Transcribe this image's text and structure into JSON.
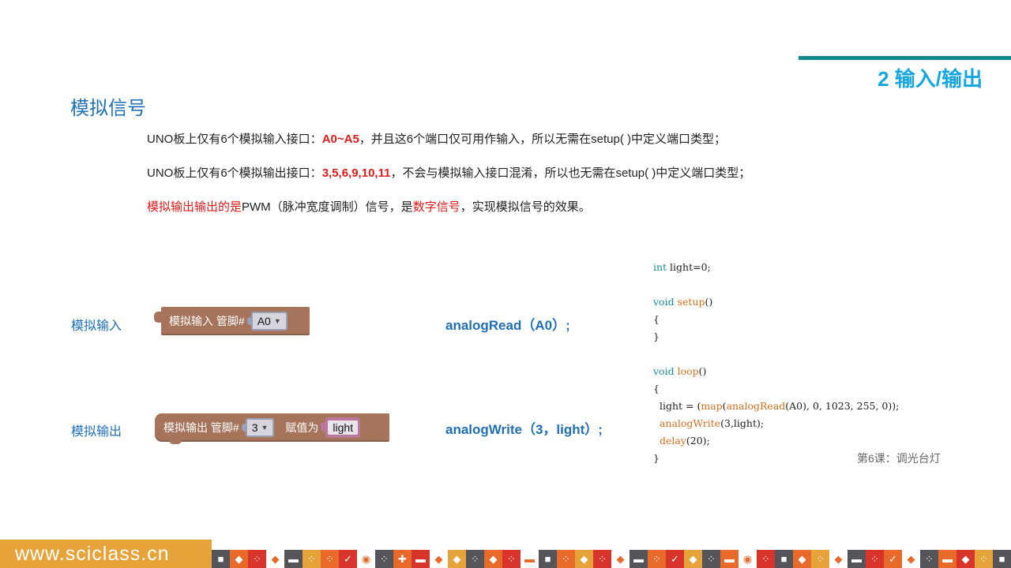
{
  "header": {
    "section_heading": "2 输入/输出",
    "title": "模拟信号"
  },
  "paragraphs": {
    "p1": {
      "prefix": "UNO板上仅有6个模拟输入接口：",
      "highlight": "A0~A5",
      "suffix": "，并且这6个端口仅可用作输入，所以无需在setup( )中定义端口类型；"
    },
    "p2": {
      "prefix": "UNO板上仅有6个模拟输出接口：",
      "highlight": "3,5,6,9,10,11",
      "suffix": "，不会与模拟输入接口混淆，所以也无需在setup( )中定义端口类型；"
    },
    "p3": {
      "red1": "模拟输出输出的是",
      "mid1": "PWM（脉冲宽度调制）信号，是",
      "red2": "数字信号",
      "end": "，实现模拟信号的效果。"
    }
  },
  "rows": {
    "input": {
      "label": "模拟输入",
      "block_text": "模拟输入 管脚#",
      "pin_value": "A0",
      "code": "analogRead（A0）;"
    },
    "output": {
      "label": "模拟输出",
      "block_text": "模拟输出 管脚#",
      "pin_value": "3",
      "assign_label": "赋值为",
      "var_value": "light",
      "code": "analogWrite（3，light）;"
    }
  },
  "code": {
    "l1_kw": "int",
    "l1_rest": " light=0;",
    "l3_kw": "void",
    "l3_fn": " setup",
    "l3_rest": "()",
    "l4": "{",
    "l5": "}",
    "l7_kw": "void",
    "l7_fn": " loop",
    "l7_rest": "()",
    "l8": "{",
    "l9_a": "  light = (",
    "l9_map": "map",
    "l9_b": "(",
    "l9_ar": "analogRead",
    "l9_c": "(A0), 0, 1023, 255, 0));",
    "l10_a": "  ",
    "l10_aw": "analogWrite",
    "l10_b": "(3,light);",
    "l11_a": "  ",
    "l11_d": "delay",
    "l11_b": "(20);",
    "l12": "}"
  },
  "lesson_label": "第6课：调光台灯",
  "footer": {
    "site": "www.sciclass.cn"
  }
}
